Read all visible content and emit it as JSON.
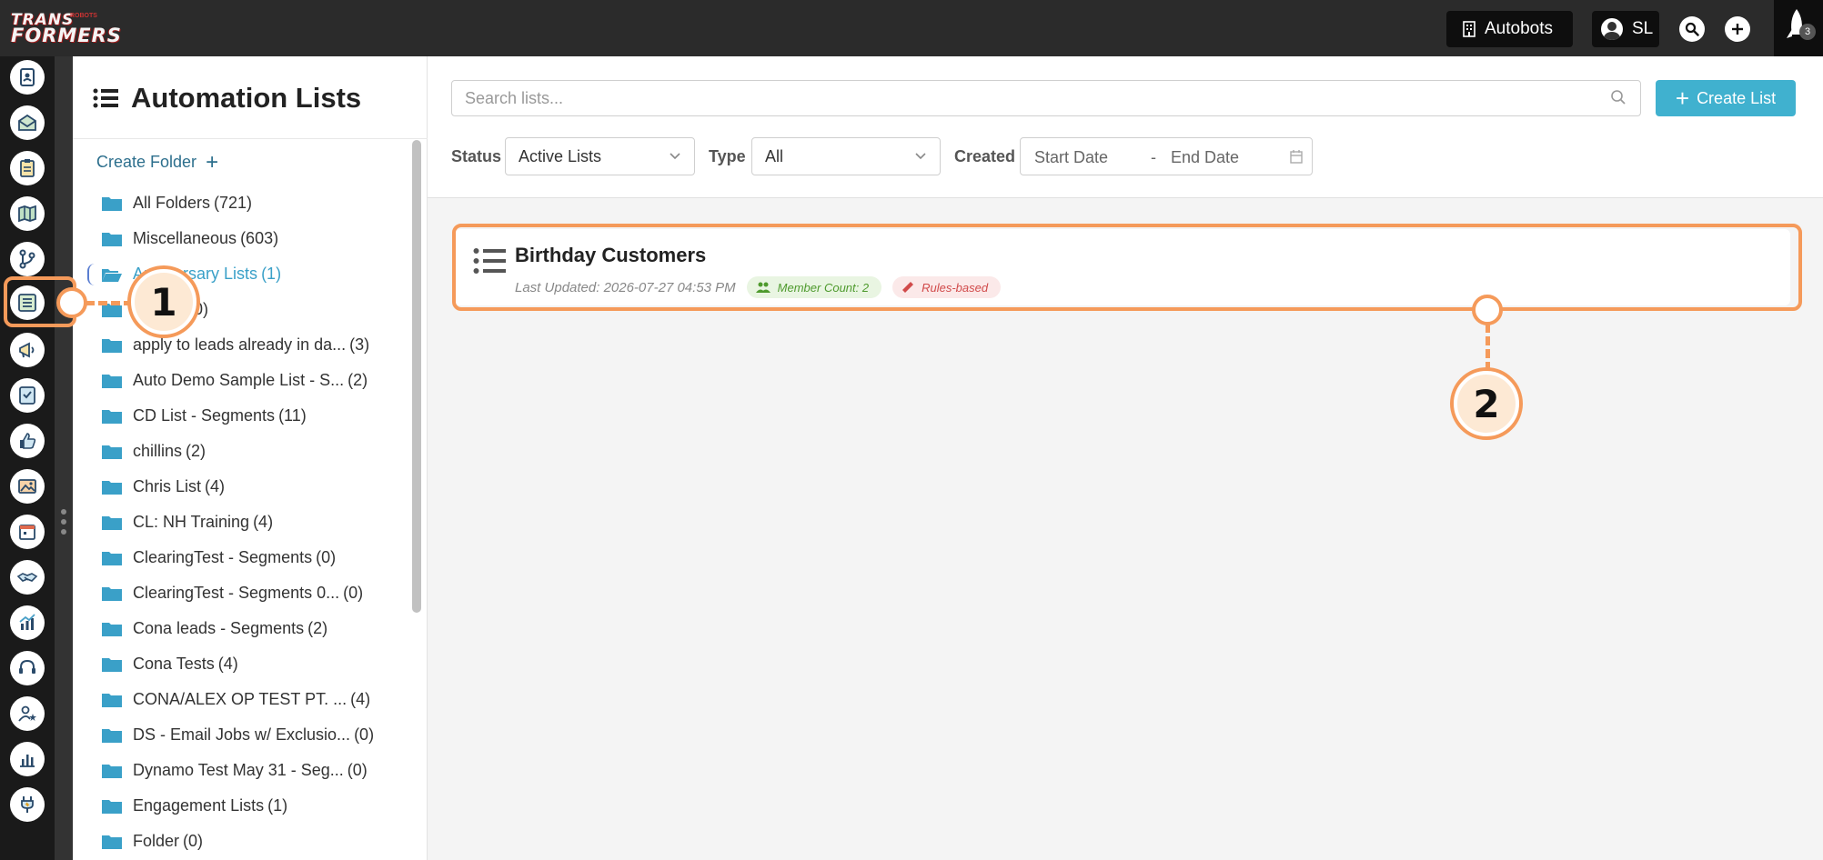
{
  "app": {
    "logo_top": "TRANS",
    "logo_bottom": "FORMERS",
    "logo_tag": "ROBOTS"
  },
  "topbar": {
    "account_label": "Autobots",
    "user_initials": "SL",
    "notification_count": "3"
  },
  "sidebar_icons": [
    "contacts-icon",
    "email-icon",
    "clipboard-icon",
    "map-icon",
    "workflow-icon",
    "list-icon",
    "megaphone-icon",
    "survey-icon",
    "thumbs-up-icon",
    "image-icon",
    "calendar-icon",
    "handshake-icon",
    "analytics-icon",
    "headset-icon",
    "user-star-icon",
    "bar-chart-icon",
    "plug-icon"
  ],
  "left_panel": {
    "title": "Automation Lists",
    "create_folder_label": "Create Folder",
    "folders": [
      {
        "name": "All Folders",
        "count": "(721)",
        "active": false
      },
      {
        "name": "Miscellaneous",
        "count": "(603)",
        "active": false
      },
      {
        "name": "Anniversary Lists",
        "count": "(1)",
        "active": true
      },
      {
        "name": "... Lists",
        "count": "(0)",
        "active": false
      },
      {
        "name": "apply to leads already in da...",
        "count": "(3)",
        "active": false
      },
      {
        "name": "Auto Demo Sample List - S...",
        "count": "(2)",
        "active": false
      },
      {
        "name": "CD List - Segments",
        "count": "(11)",
        "active": false
      },
      {
        "name": "chillins",
        "count": "(2)",
        "active": false
      },
      {
        "name": "Chris List",
        "count": "(4)",
        "active": false
      },
      {
        "name": "CL: NH Training",
        "count": "(4)",
        "active": false
      },
      {
        "name": "ClearingTest - Segments",
        "count": "(0)",
        "active": false
      },
      {
        "name": "ClearingTest - Segments 0...",
        "count": "(0)",
        "active": false
      },
      {
        "name": "Cona leads - Segments",
        "count": "(2)",
        "active": false
      },
      {
        "name": "Cona Tests",
        "count": "(4)",
        "active": false
      },
      {
        "name": "CONA/ALEX OP TEST PT. ...",
        "count": "(4)",
        "active": false
      },
      {
        "name": "DS - Email Jobs w/ Exclusio...",
        "count": "(0)",
        "active": false
      },
      {
        "name": "Dynamo Test May 31 - Seg...",
        "count": "(0)",
        "active": false
      },
      {
        "name": "Engagement Lists",
        "count": "(1)",
        "active": false
      },
      {
        "name": "Folder",
        "count": "(0)",
        "active": false
      }
    ]
  },
  "main": {
    "search_placeholder": "Search lists...",
    "create_list_label": "Create List",
    "filters": {
      "status_label": "Status",
      "status_value": "Active Lists",
      "type_label": "Type",
      "type_value": "All",
      "created_label": "Created",
      "start_placeholder": "Start Date",
      "separator": "-",
      "end_placeholder": "End Date"
    },
    "lists": [
      {
        "title": "Birthday Customers",
        "last_updated": "Last Updated: 2026-07-27 04:53 PM",
        "member_count": "Member Count: 2",
        "type_badge": "Rules-based"
      }
    ]
  },
  "annotations": {
    "callout_1": "1",
    "callout_2": "2",
    "color": "#f59a5a"
  },
  "colors": {
    "accent": "#40b1cf",
    "active_folder": "#3aa0c8",
    "link": "#2d6f8d",
    "folder_icon": "#3aa0c8"
  }
}
